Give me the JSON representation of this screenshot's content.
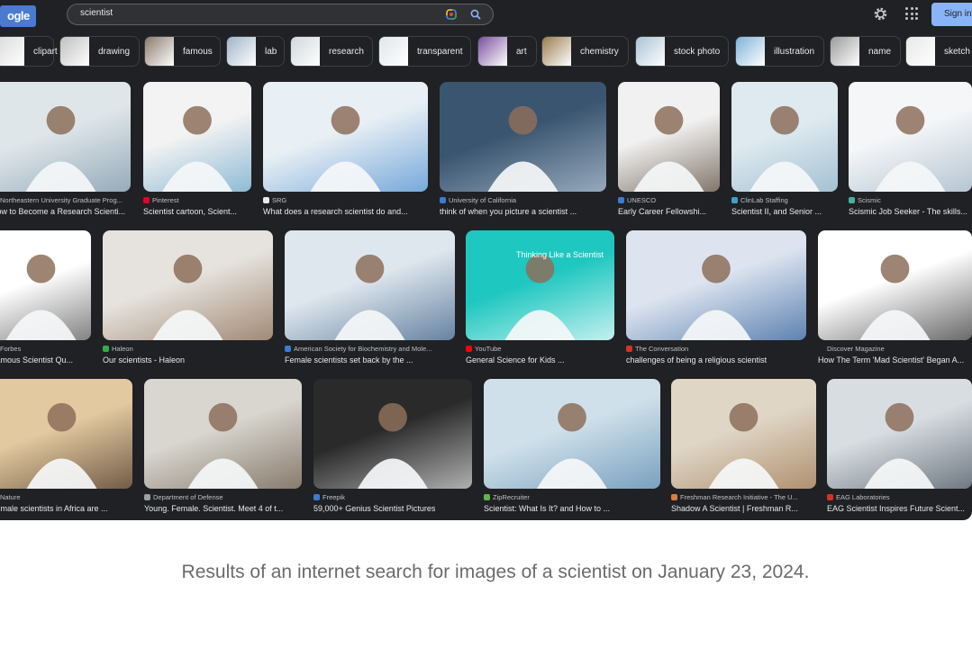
{
  "header": {
    "logo_text": "ogle",
    "search_value": "scientist",
    "signin_label": "Sign in"
  },
  "chips": [
    {
      "label": "clipart",
      "color": "#d9d9d9"
    },
    {
      "label": "drawing",
      "color": "#bfbfbf"
    },
    {
      "label": "famous",
      "color": "#8a7a6a"
    },
    {
      "label": "lab",
      "color": "#9fb4c8"
    },
    {
      "label": "research",
      "color": "#cfd8dc"
    },
    {
      "label": "transparent",
      "color": "#e0e6ea"
    },
    {
      "label": "art",
      "color": "#7a4fa0"
    },
    {
      "label": "chemistry",
      "color": "#9a7c4d"
    },
    {
      "label": "stock photo",
      "color": "#a8c3d6"
    },
    {
      "label": "illustration",
      "color": "#7fb2d9"
    },
    {
      "label": "name",
      "color": "#9a9a9a"
    },
    {
      "label": "sketch",
      "color": "#e8e8e8"
    }
  ],
  "results": [
    {
      "source": "Northeastern University Graduate Prog...",
      "title": "How to Become a Research Scienti...",
      "fav": "#c0c0c0"
    },
    {
      "source": "Pinterest",
      "title": "Scientist cartoon, Scient...",
      "fav": "#e60023"
    },
    {
      "source": "SRG",
      "title": "What does a research scientist do and...",
      "fav": "#e8eaed"
    },
    {
      "source": "University of California",
      "title": "think of when you picture a scientist ...",
      "fav": "#3b7bd4"
    },
    {
      "source": "UNESCO",
      "title": "Early Career Fellowshi...",
      "fav": "#3b7bd4"
    },
    {
      "source": "ClinLab Staffing",
      "title": "Scientist II, and Senior ...",
      "fav": "#3fa0c8"
    },
    {
      "source": "Scismic",
      "title": "Scismic Job Seeker - The skills...",
      "fav": "#48b0a0"
    },
    {
      "source": "Forbes",
      "title": "Famous Scientist Qu...",
      "fav": "#c0c0c0"
    },
    {
      "source": "Haleon",
      "title": "Our scientists - Haleon",
      "fav": "#2fae4a"
    },
    {
      "source": "American Society for Biochemistry and Mole...",
      "title": "Female scientists set back by the ...",
      "fav": "#3b7bd4"
    },
    {
      "source": "YouTube",
      "title": "General Science for Kids ...",
      "fav": "#ff0000"
    },
    {
      "source": "The Conversation",
      "title": "challenges of being a religious scientist",
      "fav": "#d93025"
    },
    {
      "source": "Discover Magazine",
      "title": "How The Term 'Mad Scientist' Began A...",
      "fav": "#202124"
    },
    {
      "source": "Nature",
      "title": "Female scientists in Africa are ...",
      "fav": "#c0c0c0"
    },
    {
      "source": "Department of Defense",
      "title": "Young. Female. Scientist. Meet 4 of t...",
      "fav": "#9aa0a6"
    },
    {
      "source": "Freepik",
      "title": "59,000+ Genius Scientist Pictures",
      "fav": "#3b7bd4"
    },
    {
      "source": "ZipRecruiter",
      "title": "Scientist: What Is It? and How to ...",
      "fav": "#5fb648"
    },
    {
      "source": "Freshman Research Initiative - The U...",
      "title": "Shadow A Scientist | Freshman R...",
      "fav": "#e07b39"
    },
    {
      "source": "EAG Laboratories",
      "title": "EAG Scientist Inspires Future Scient...",
      "fav": "#d93025"
    }
  ],
  "thumb_text": {
    "youtube_overlay": "Thinking Like a Scientist"
  },
  "caption": "Results of an internet search for images of a scientist on January 23, 2024."
}
